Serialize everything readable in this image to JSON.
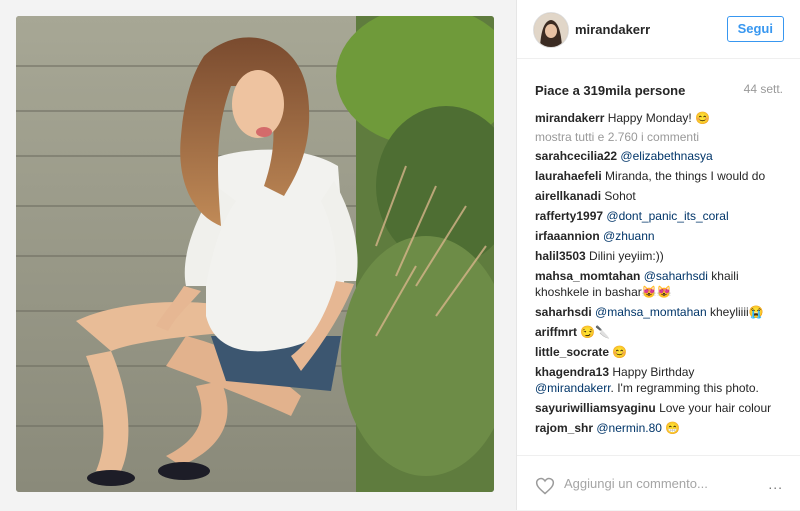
{
  "post": {
    "username": "mirandakerr",
    "follow_label": "Segui",
    "likes_text": "Piace a 319mila persone",
    "time_ago": "44 sett.",
    "caption": {
      "user": "mirandakerr",
      "text": "Happy Monday! 😊"
    },
    "show_all_comments": "mostra tutti e 2.760 i commenti",
    "comments": [
      {
        "user": "sarahcecilia22",
        "mention": "@elizabethnasya",
        "text": ""
      },
      {
        "user": "laurahaefeli",
        "mention": "",
        "text": "Miranda, the things I would do"
      },
      {
        "user": "airellkanadi",
        "mention": "",
        "text": "Sohot"
      },
      {
        "user": "rafferty1997",
        "mention": "@dont_panic_its_coral",
        "text": ""
      },
      {
        "user": "irfaaannion",
        "mention": "@zhuann",
        "text": ""
      },
      {
        "user": "halil3503",
        "mention": "",
        "text": "Dilini yeyiim:))"
      },
      {
        "user": "mahsa_momtahan",
        "mention": "@saharhsdi",
        "text": "khaili khoshkele in bashar😻😻"
      },
      {
        "user": "saharhsdi",
        "mention": "@mahsa_momtahan",
        "text": "kheyliiii😭"
      },
      {
        "user": "ariffmrt",
        "mention": "",
        "text": "😏🔪"
      },
      {
        "user": "little_socrate",
        "mention": "",
        "text": "😊"
      },
      {
        "user": "khagendra13",
        "mention": "",
        "text": "Happy Birthday",
        "mention_after": "@mirandakerr",
        "text_after": ". I'm regramming this photo."
      },
      {
        "user": "sayuriwilliamsyaginu",
        "mention": "",
        "text": "Love your hair colour"
      },
      {
        "user": "rajom_shr",
        "mention": "@nermin.80",
        "text": "😁"
      }
    ],
    "add_comment_placeholder": "Aggiungi un commento...",
    "more_options": "..."
  },
  "icons": {
    "heart": "heart-icon",
    "more": "more-options-icon"
  }
}
